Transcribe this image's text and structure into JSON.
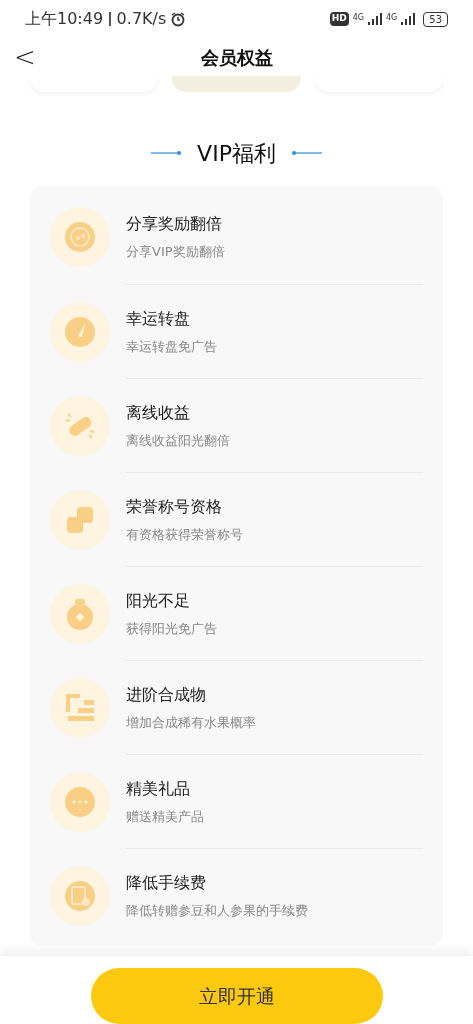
{
  "status_bar": {
    "time": "上午10:49",
    "speed": "0.7K/s",
    "hd": "HD",
    "network_1": "4G",
    "network_2": "4G",
    "battery": "53"
  },
  "header": {
    "back": "<",
    "title": "会员权益"
  },
  "plans": [
    {
      "selected": false
    },
    {
      "selected": true
    },
    {
      "selected": false
    }
  ],
  "section_title": "VIP福利",
  "benefits": [
    {
      "kind": "share",
      "title": "分享奖励翻倍",
      "subtitle": "分享VIP奖励翻倍"
    },
    {
      "kind": "wheel",
      "title": "幸运转盘",
      "subtitle": "幸运转盘免广告"
    },
    {
      "kind": "offline",
      "title": "离线收益",
      "subtitle": "离线收益阳光翻倍"
    },
    {
      "kind": "honor",
      "title": "荣誉称号资格",
      "subtitle": "有资格获得荣誉称号"
    },
    {
      "kind": "bag",
      "title": "阳光不足",
      "subtitle": "获得阳光免广告"
    },
    {
      "kind": "upgrade",
      "title": "进阶合成物",
      "subtitle": "增加合成稀有水果概率"
    },
    {
      "kind": "gift",
      "title": "精美礼品",
      "subtitle": "赠送精美产品"
    },
    {
      "kind": "fee",
      "title": "降低手续费",
      "subtitle": "降低转赠参豆和人参果的手续费"
    }
  ],
  "action_button": "立即开通"
}
